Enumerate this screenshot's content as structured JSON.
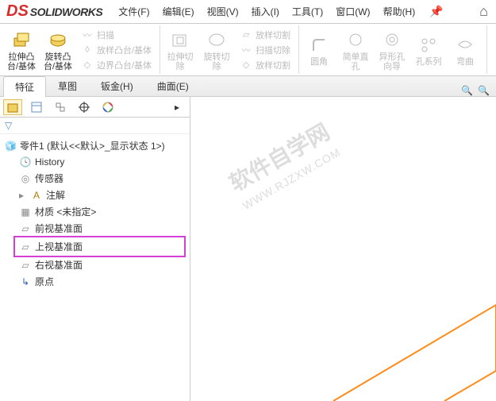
{
  "app": {
    "name": "SOLIDWORKS"
  },
  "menu": {
    "file": "文件(F)",
    "edit": "编辑(E)",
    "view": "视图(V)",
    "insert": "插入(I)",
    "tools": "工具(T)",
    "window": "窗口(W)",
    "help": "帮助(H)"
  },
  "ribbon": {
    "extrude_boss": "拉伸凸\n台/基体",
    "revolve_boss": "旋转凸\n台/基体",
    "sweep": "扫描",
    "loft_boss": "放样凸台/基体",
    "boundary_boss": "边界凸台/基体",
    "extrude_cut": "拉伸切\n除",
    "revolve_cut": "旋转切\n除",
    "loft_cut": "放样切割",
    "sweep_cut": "扫描切除",
    "boundary_cut": "放样切割",
    "fillet": "圆角",
    "simple_hole": "简单直\n孔",
    "hole_wizard": "异形孔\n向导",
    "hole_array": "孔系列",
    "wrap": "弯曲"
  },
  "tabs": {
    "feature": "特征",
    "sketch": "草图",
    "sheetmetal": "钣金(H)",
    "surface": "曲面(E)"
  },
  "tree": {
    "root": "零件1  (默认<<默认>_显示状态 1>)",
    "history": "History",
    "sensors": "传感器",
    "annotations": "注解",
    "material": "材质 <未指定>",
    "plane_front": "前视基准面",
    "plane_top": "上视基准面",
    "plane_right": "右视基准面",
    "origin": "原点"
  },
  "watermark": {
    "main": "软件自学网",
    "sub": "WWW.RJZXW.COM"
  }
}
